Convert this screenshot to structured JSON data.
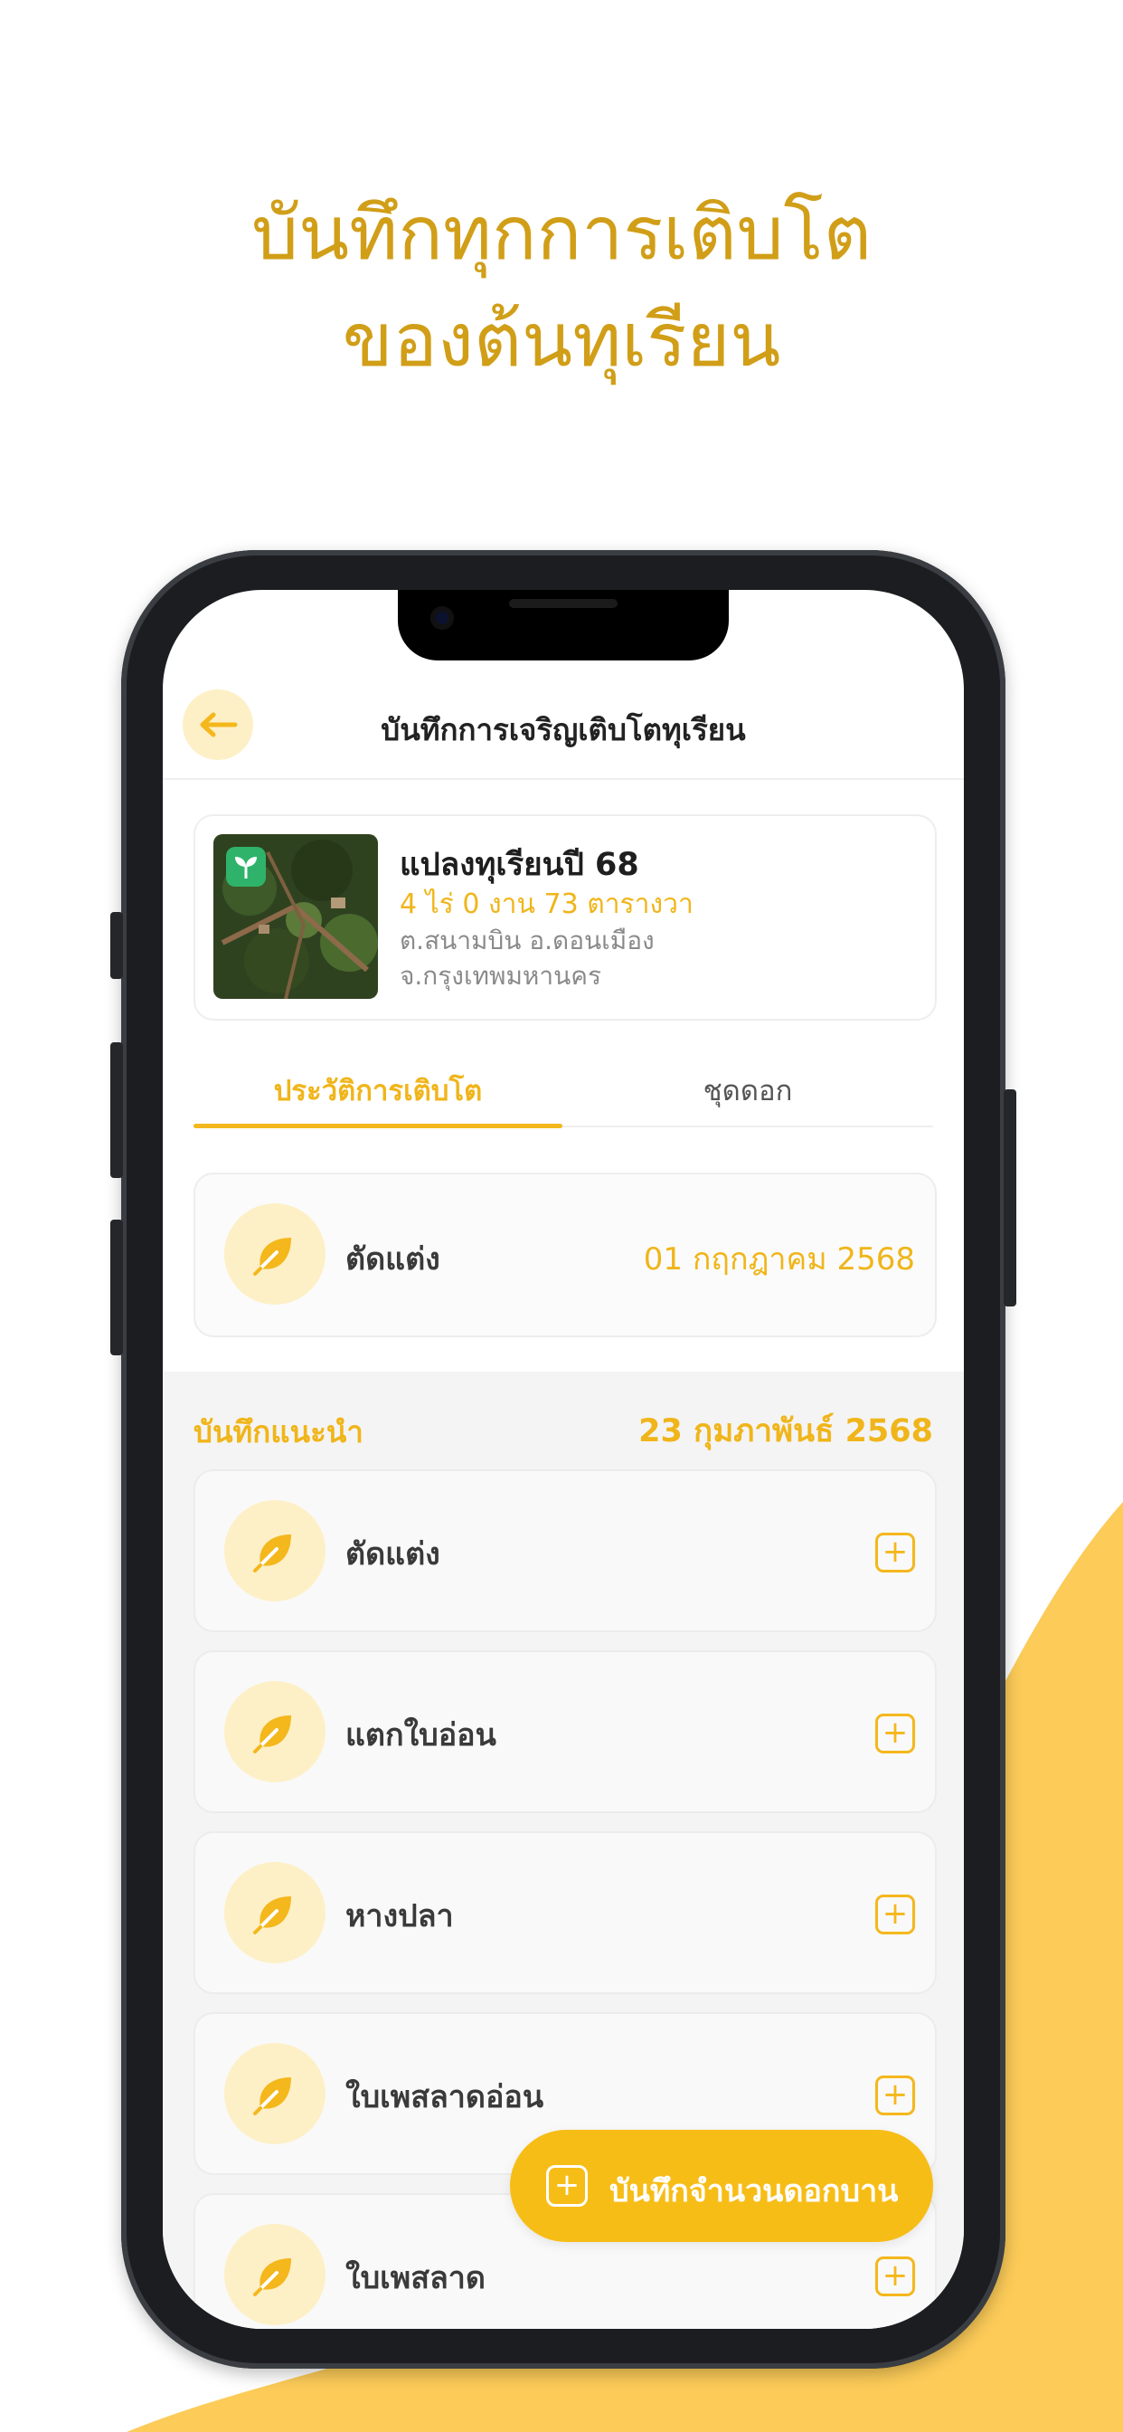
{
  "marketing": {
    "headline_line1": "บันทึกทุกการเติบโต",
    "headline_line2": "ของต้นทุเรียน"
  },
  "colors": {
    "accent": "#f4b71c",
    "accent_text": "#d19e18",
    "accent_light": "#fdf0c6"
  },
  "header": {
    "back_icon": "arrow-left-icon",
    "title": "บันทึกการเจริญเติบโตทุเรียน"
  },
  "plot": {
    "name": "แปลงทุเรียนปี 68",
    "area": "4 ไร่ 0 งาน 73 ตารางวา",
    "address_line1": "ต.สนามบิน อ.ดอนเมือง",
    "address_line2": "จ.กรุงเทพมหานคร",
    "badge_icon": "sprout-icon"
  },
  "tabs": [
    {
      "label": "ประวัติการเติบโต",
      "active": true
    },
    {
      "label": "ชุดดอก",
      "active": false
    }
  ],
  "latest_record": {
    "label": "ตัดแต่ง",
    "date": "01 กฤกฎาคม 2568",
    "icon": "leaf-icon"
  },
  "suggested": {
    "title": "บันทึกแนะนำ",
    "date": "23 กุมภาพันธ์ 2568",
    "items": [
      {
        "label": "ตัดแต่ง"
      },
      {
        "label": "แตกใบอ่อน"
      },
      {
        "label": "หางปลา"
      },
      {
        "label": "ใบเพสลาดอ่อน"
      },
      {
        "label": "ใบเพสลาด"
      }
    ],
    "add_symbol": "+"
  },
  "fab": {
    "label": "บันทึกจำนวนดอกบาน",
    "icon_symbol": "+"
  }
}
